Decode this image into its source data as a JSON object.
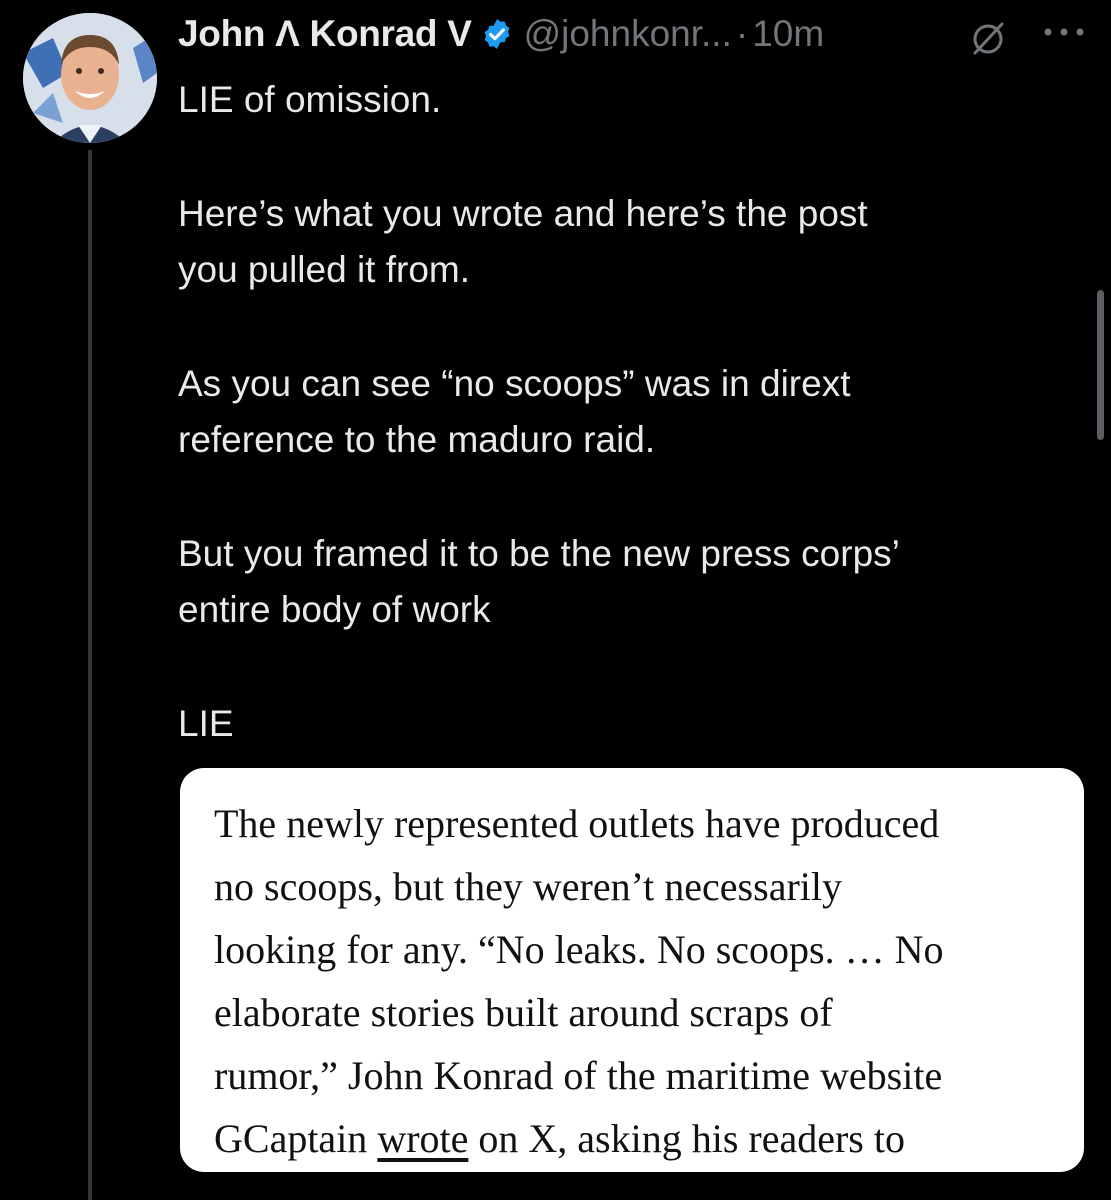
{
  "author": {
    "display_name": "John Λ Konrad V",
    "handle": "@johnkonr...",
    "separator": "·",
    "timestamp": "10m",
    "verified": true
  },
  "icons": {
    "avatar": "profile-photo",
    "verified": "verified-badge-icon",
    "grok": "grok-icon",
    "more": "more-icon"
  },
  "colors": {
    "background": "#000000",
    "text": "#e7e9ea",
    "muted": "#71767b",
    "verified": "#1d9bf0"
  },
  "tweet": {
    "line1": "LIE of omission.",
    "para2_line1": "Here’s what you wrote and here’s the post",
    "para2_line2": "you pulled it from.",
    "para3_line1": "As you can see “no scoops” was in dirext",
    "para3_line2": "reference to the maduro raid.",
    "para4_line1": "But you framed it to be the new press corps’",
    "para4_line2": "entire body of work",
    "para5": "LIE"
  },
  "quote": {
    "line1": "The newly represented outlets have produced",
    "line2": "no scoops, but they weren’t necessarily",
    "line3": "looking for any. “No leaks. No scoops. … No",
    "line4": "elaborate stories built around scraps of",
    "line5": "rumor,” John Konrad of the maritime website",
    "line6_before_link": "GCaptain ",
    "line6_link": "wrote",
    "line6_after_link": " on X, asking his readers to"
  }
}
